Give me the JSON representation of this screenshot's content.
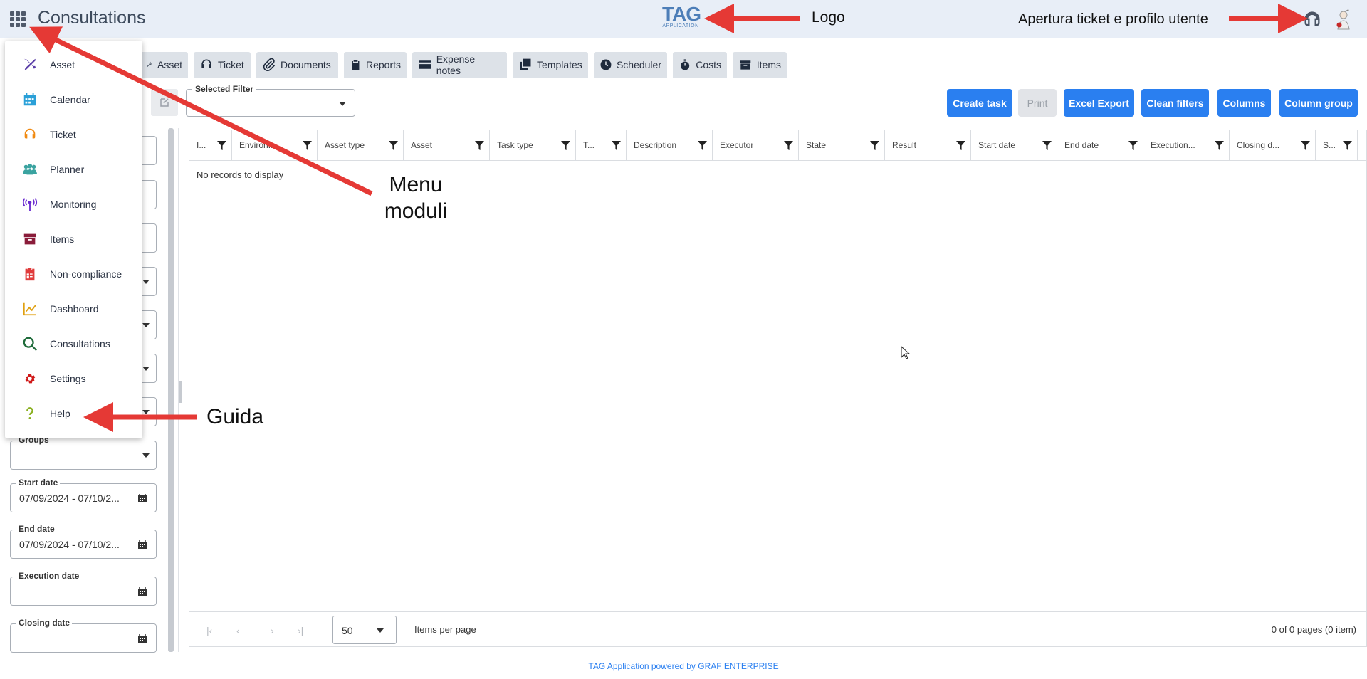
{
  "header": {
    "title": "Consultations",
    "logo_text": "TAG",
    "logo_sub": "APPLICATION"
  },
  "tabs": [
    {
      "label": "Asset",
      "icon": "wrench-icon"
    },
    {
      "label": "Ticket",
      "icon": "headset-icon"
    },
    {
      "label": "Documents",
      "icon": "paperclip-icon"
    },
    {
      "label": "Reports",
      "icon": "clipboard-icon"
    },
    {
      "label": "Expense notes",
      "icon": "credit-card-icon"
    },
    {
      "label": "Templates",
      "icon": "copy-icon"
    },
    {
      "label": "Scheduler",
      "icon": "clock-icon"
    },
    {
      "label": "Costs",
      "icon": "stopwatch-icon"
    },
    {
      "label": "Items",
      "icon": "box-icon"
    }
  ],
  "toolbar": {
    "selected_filter_label": "Selected Filter",
    "selected_filter_value": "",
    "buttons": {
      "create_task": "Create task",
      "print": "Print",
      "excel_export": "Excel Export",
      "clean_filters": "Clean filters",
      "columns": "Columns",
      "column_group": "Column group"
    }
  },
  "left_panel": {
    "groups_label": "Groups",
    "start_date_label": "Start date",
    "start_date_value": "07/09/2024 - 07/10/2...",
    "end_date_label": "End date",
    "end_date_value": "07/09/2024 - 07/10/2...",
    "execution_date_label": "Execution date",
    "closing_date_label": "Closing date"
  },
  "grid": {
    "columns": [
      "I...",
      "Environ...",
      "Asset type",
      "Asset",
      "Task type",
      "T...",
      "Description",
      "Executor",
      "State",
      "Result",
      "Start date",
      "End date",
      "Execution...",
      "Closing d...",
      "S..."
    ],
    "empty_message": "No records to display",
    "pager": {
      "page_size": "50",
      "items_per_page_label": "Items per page",
      "info": "0 of 0 pages (0 item)"
    }
  },
  "menu": {
    "items": [
      {
        "label": "Asset",
        "icon": "tools-icon",
        "color": "#5b3fa8"
      },
      {
        "label": "Calendar",
        "icon": "calendar-icon",
        "color": "#2aa0d8"
      },
      {
        "label": "Ticket",
        "icon": "headset-icon",
        "color": "#f08a12"
      },
      {
        "label": "Planner",
        "icon": "users-icon",
        "color": "#3aa3a0"
      },
      {
        "label": "Monitoring",
        "icon": "antenna-icon",
        "color": "#6a2bd0"
      },
      {
        "label": "Items",
        "icon": "box-icon",
        "color": "#8a1c3a"
      },
      {
        "label": "Non-compliance",
        "icon": "clipboard-check-icon",
        "color": "#e03b3b"
      },
      {
        "label": "Dashboard",
        "icon": "chart-line-icon",
        "color": "#e0a010"
      },
      {
        "label": "Consultations",
        "icon": "search-icon",
        "color": "#1f6b3a"
      },
      {
        "label": "Settings",
        "icon": "gear-icon",
        "color": "#d01818"
      },
      {
        "label": "Help",
        "icon": "question-icon",
        "color": "#8ab020"
      }
    ]
  },
  "annotations": {
    "logo": "Logo",
    "ticket_profile": "Apertura ticket e profilo utente",
    "menu_line1": "Menu",
    "menu_line2": "moduli",
    "help": "Guida"
  },
  "footer": "TAG Application powered by GRAF ENTERPRISE",
  "colors": {
    "accent": "#2a7ff0",
    "header_bg": "#e8eef7",
    "annotation_arrow": "#e53935"
  }
}
